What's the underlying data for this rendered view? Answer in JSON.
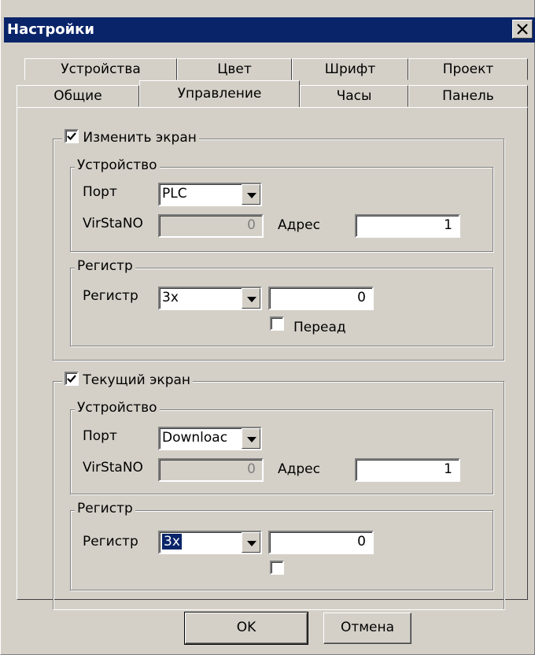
{
  "window": {
    "title": "Настройки",
    "close_glyph": "✕"
  },
  "tabs": {
    "row1": [
      "Устройства",
      "Цвет",
      "Шрифт",
      "Проект"
    ],
    "row2": [
      "Общие",
      "Управление",
      "Часы",
      "Панель"
    ],
    "selected": "Управление"
  },
  "change_screen": {
    "title": "Изменить экран",
    "checked": true,
    "device": {
      "title": "Устройство",
      "port_label": "Порт",
      "port_value": "PLC",
      "virstano_label": "VirStaNO",
      "virstano_value": "0",
      "address_label": "Адрес",
      "address_value": "1"
    },
    "register": {
      "title": "Регистр",
      "register_label": "Регистр",
      "register_value": "3x",
      "register_number": "0",
      "reverse_label": "Переад",
      "reverse_checked": false
    }
  },
  "current_screen": {
    "title": "Текущий экран",
    "checked": true,
    "device": {
      "title": "Устройство",
      "port_label": "Порт",
      "port_value": "Downloac",
      "virstano_label": "VirStaNO",
      "virstano_value": "0",
      "address_label": "Адрес",
      "address_value": "1"
    },
    "register": {
      "title": "Регистр",
      "register_label": "Регистр",
      "register_value": "3x",
      "register_number": "0",
      "extra_checked": false
    }
  },
  "buttons": {
    "ok": "OK",
    "cancel": "Отмена"
  }
}
